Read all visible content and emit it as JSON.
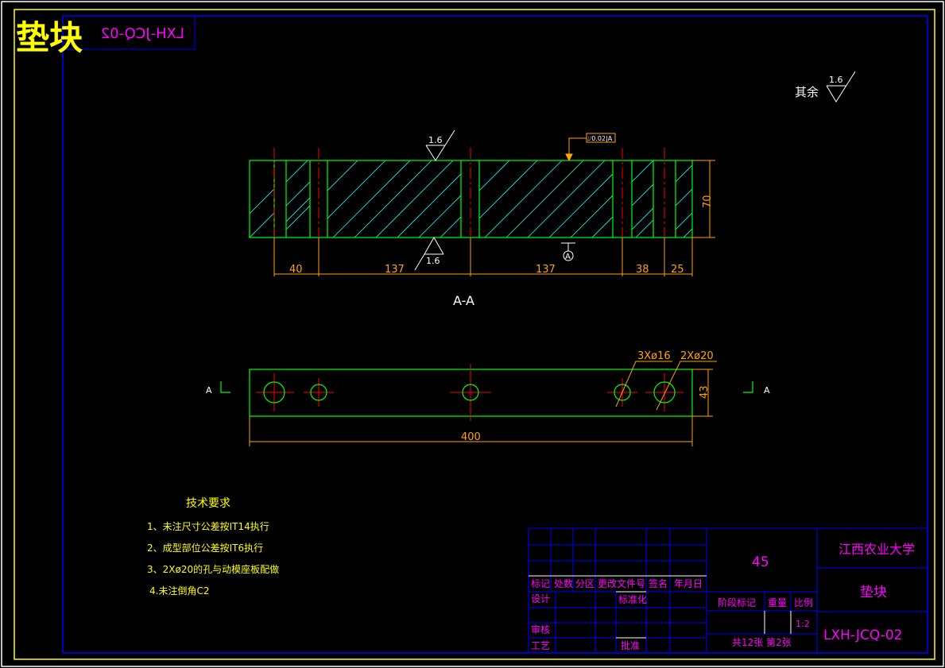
{
  "stamp": {
    "title": "垫块",
    "mirrored_code": "LXH-JCQ-02"
  },
  "roughness": {
    "other_label": "其余",
    "other_value": "1.6",
    "top_value": "1.6",
    "bottom_value": "1.6"
  },
  "tolerance_frame": {
    "text": "⌰0.02|A"
  },
  "datum": "A",
  "section": {
    "title": "A-A",
    "height": "70",
    "dims": [
      "40",
      "137",
      "137",
      "38",
      "25"
    ]
  },
  "plan": {
    "length": "400",
    "width": "43",
    "hole_label_1": "3Xø16",
    "hole_label_2": "2Xø20",
    "section_mark": "A"
  },
  "tech": {
    "title": "技术要求",
    "items": [
      "1、未注尺寸公差按IT14执行",
      "2、成型部位公差按IT6执行",
      "3、2Xø20的孔与动模座板配做",
      "4.未注倒角C2"
    ]
  },
  "title_block": {
    "material": "45",
    "school": "江西农业大学",
    "part_name": "垫块",
    "drawing_no": "LXH-JCQ-02",
    "headers": [
      "标记",
      "处数",
      "分区",
      "更改文件号",
      "签名",
      "年月日"
    ],
    "design": "设计",
    "standardize": "标准化",
    "review": "审核",
    "process": "工艺",
    "approve": "批准",
    "stage_mark": "阶段标记",
    "weight": "重量",
    "scale_label": "比例",
    "scale": "1:2",
    "sheets": "共12张 第2张"
  }
}
